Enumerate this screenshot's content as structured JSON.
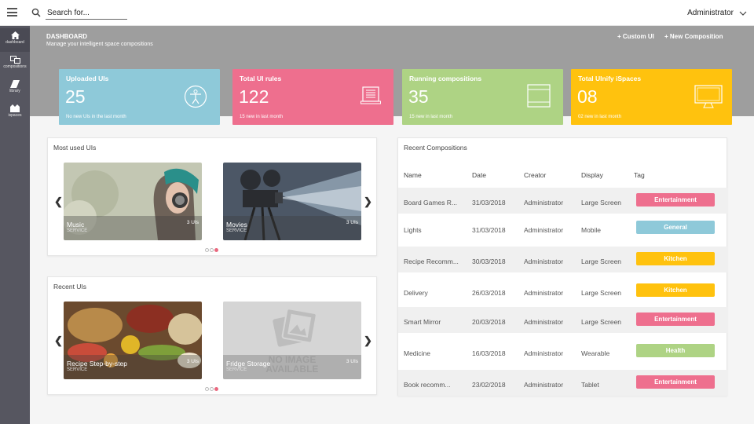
{
  "topbar": {
    "search_placeholder": "Search for...",
    "user": "Administrator"
  },
  "sidebar": {
    "items": [
      {
        "label": "dashboard",
        "icon": "home-icon"
      },
      {
        "label": "compositions",
        "icon": "compositions-icon"
      },
      {
        "label": "library",
        "icon": "library-icon"
      },
      {
        "label": "ispaces",
        "icon": "ispaces-icon"
      }
    ]
  },
  "header": {
    "title": "DASHBOARD",
    "subtitle": "Manage your intelligent space compositions",
    "custom_ui_label": "+ Custom UI",
    "new_composition_label": "+ New Composition"
  },
  "stats": [
    {
      "title": "Uploaded UIs",
      "value": "25",
      "sub": "No new UIs in the last month",
      "color": "#8ec9d9",
      "icon": "accessibility-icon"
    },
    {
      "title": "Total UI rules",
      "value": "122",
      "sub": "15 new in last month",
      "color": "#ee6f8e",
      "icon": "document-icon"
    },
    {
      "title": "Running compositions",
      "value": "35",
      "sub": "15 new in last month",
      "color": "#aed384",
      "icon": "window-icon"
    },
    {
      "title": "Total UInify iSpaces",
      "value": "08",
      "sub": "02 new in last month",
      "color": "#ffc20e",
      "icon": "monitor-icon"
    }
  ],
  "most_used": {
    "title": "Most used UIs",
    "tiles": [
      {
        "name": "Music",
        "type": "SERVICE",
        "count": "3 UIs"
      },
      {
        "name": "Movies",
        "type": "SERVICE",
        "count": "3 UIs"
      }
    ]
  },
  "recent_uis": {
    "title": "Recent UIs",
    "tiles": [
      {
        "name": "Recipe Step-by-step",
        "type": "SERVICE",
        "count": "3 UIs"
      },
      {
        "name": "Fridge Storage",
        "type": "SERVICE",
        "count": "3 UIs",
        "placeholder": [
          "NO IMAGE",
          "AVAILABLE"
        ]
      }
    ]
  },
  "recent_compositions": {
    "title": "Recent Compositions",
    "columns": [
      "Name",
      "Date",
      "Creator",
      "Display",
      "Tag"
    ],
    "rows": [
      {
        "name": "Board Games R...",
        "date": "31/03/2018",
        "creator": "Administrator",
        "display": "Large Screen",
        "tag": "Entertainment",
        "tag_color": "#ee6f8e"
      },
      {
        "name": "Lights",
        "date": "31/03/2018",
        "creator": "Administrator",
        "display": "Mobile",
        "tag": "General",
        "tag_color": "#8ec9d9"
      },
      {
        "name": "Recipe Recomm...",
        "date": "30/03/2018",
        "creator": "Administrator",
        "display": "Large Screen",
        "tag": "Kitchen",
        "tag_color": "#ffc20e"
      },
      {
        "name": "Delivery",
        "date": "26/03/2018",
        "creator": "Administrator",
        "display": "Large Screen",
        "tag": "Kitchen",
        "tag_color": "#ffc20e"
      },
      {
        "name": "Smart Mirror",
        "date": "20/03/2018",
        "creator": "Administrator",
        "display": "Large Screen",
        "tag": "Entertainment",
        "tag_color": "#ee6f8e"
      },
      {
        "name": "Medicine",
        "date": "16/03/2018",
        "creator": "Administrator",
        "display": "Wearable",
        "tag": "Health",
        "tag_color": "#aed384"
      },
      {
        "name": "Book recomm...",
        "date": "23/02/2018",
        "creator": "Administrator",
        "display": "Tablet",
        "tag": "Entertainment",
        "tag_color": "#ee6f8e"
      }
    ]
  }
}
